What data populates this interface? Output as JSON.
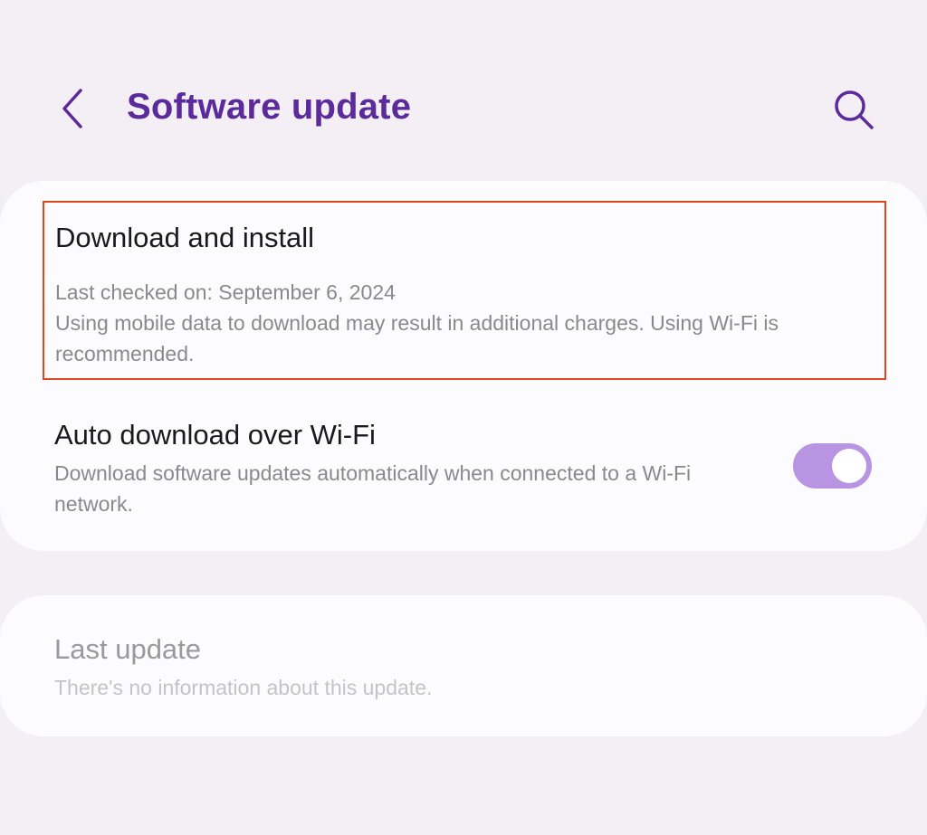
{
  "header": {
    "title": "Software update",
    "back_icon": "chevron-left-icon",
    "search_icon": "search-icon",
    "accent_color": "#5b2a9b"
  },
  "updates_card": {
    "download": {
      "title": "Download and install",
      "last_checked": "Last checked on: September 6, 2024",
      "note": "Using mobile data to download may result in additional charges. Using Wi-Fi is recommended.",
      "highlight_color": "#e2461f"
    },
    "auto_download": {
      "title": "Auto download over Wi-Fi",
      "description": "Download software updates automatically when connected to a Wi-Fi network.",
      "enabled": true,
      "toggle_color": "#b894e3"
    }
  },
  "last_update_card": {
    "title": "Last update",
    "description": "There's no information about this update."
  }
}
